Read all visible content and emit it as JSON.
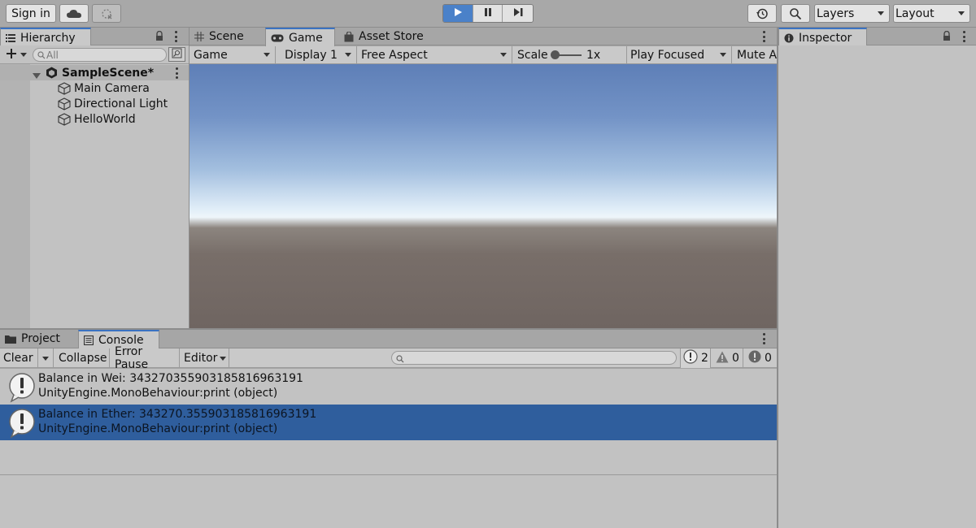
{
  "toolbar": {
    "sign_in": "Sign in",
    "layers": "Layers",
    "layout": "Layout"
  },
  "hierarchy": {
    "title": "Hierarchy",
    "search_placeholder": "All",
    "scene": "SampleScene*",
    "items": [
      "Main Camera",
      "Directional Light",
      "HelloWorld"
    ]
  },
  "center_tabs": {
    "scene": "Scene",
    "game": "Game",
    "asset_store": "Asset Store"
  },
  "game_toolbar": {
    "view": "Game",
    "display": "Display 1",
    "aspect": "Free Aspect",
    "scale_label": "Scale",
    "scale_value": "1x",
    "play_mode": "Play Focused",
    "mute": "Mute Au"
  },
  "inspector": {
    "title": "Inspector"
  },
  "bottom_tabs": {
    "project": "Project",
    "console": "Console"
  },
  "console": {
    "clear": "Clear",
    "collapse": "Collapse",
    "error_pause": "Error Pause",
    "editor": "Editor",
    "log_count": "2",
    "warning_count": "0",
    "error_count": "0",
    "entries": [
      {
        "message": "Balance in Wei: 343270355903185816963191",
        "trace": "UnityEngine.MonoBehaviour:print (object)",
        "selected": false
      },
      {
        "message": "Balance in Ether: 343270.355903185816963191",
        "trace": "UnityEngine.MonoBehaviour:print (object)",
        "selected": true
      }
    ]
  },
  "colors": {
    "play_active": "#4a81c9",
    "selection": "#2f5e9d",
    "tab_accent": "#3a72c2"
  }
}
